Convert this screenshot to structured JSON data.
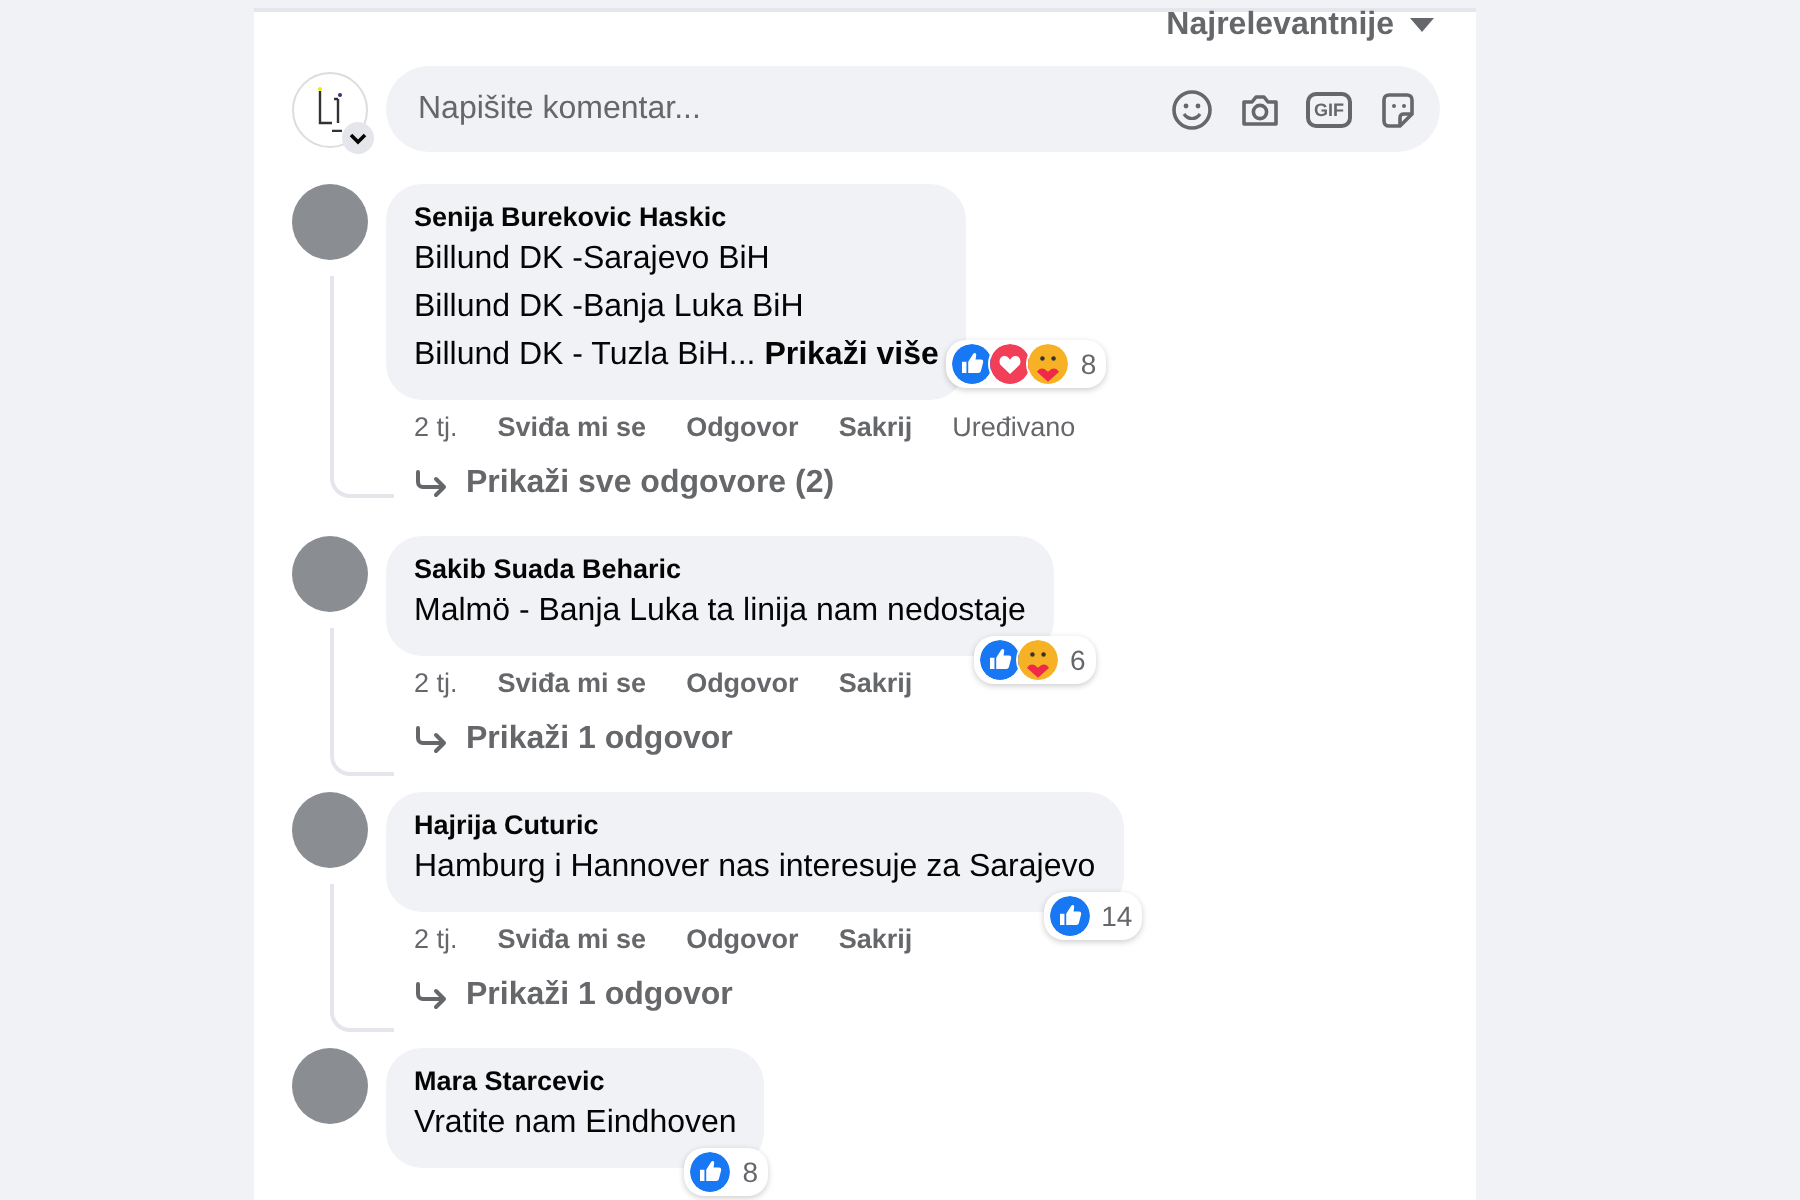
{
  "sort": {
    "label": "Najrelevantnije"
  },
  "composer": {
    "placeholder": "Napišite komentar...",
    "gif_label": "GIF"
  },
  "comments": [
    {
      "author": "Senija Burekovic Haskic",
      "lines": [
        "Billund DK -Sarajevo BiH",
        "Billund DK -Banja Luka BiH",
        "Billund DK - Tuzla BiH..."
      ],
      "more": "Prikaži više",
      "reactions": [
        {
          "kind": "like"
        },
        {
          "kind": "love"
        },
        {
          "kind": "care"
        }
      ],
      "count": "8",
      "time": "2 tj.",
      "actions": [
        "Sviđa mi se",
        "Odgovor",
        "Sakrij"
      ],
      "edited": "Uređivano",
      "replies": "Prikaži sve odgovore (2)"
    },
    {
      "author": "Sakib Suada Beharic",
      "lines": [
        "Malmö - Banja Luka ta linija nam nedostaje"
      ],
      "reactions": [
        {
          "kind": "like"
        },
        {
          "kind": "care"
        }
      ],
      "count": "6",
      "time": "2 tj.",
      "actions": [
        "Sviđa mi se",
        "Odgovor",
        "Sakrij"
      ],
      "replies": "Prikaži 1 odgovor"
    },
    {
      "author": "Hajrija Cuturic",
      "lines": [
        "Hamburg i Hannover nas interesuje za Sarajevo"
      ],
      "reactions": [
        {
          "kind": "like"
        }
      ],
      "count": "14",
      "time": "2 tj.",
      "actions": [
        "Sviđa mi se",
        "Odgovor",
        "Sakrij"
      ],
      "replies": "Prikaži 1 odgovor"
    },
    {
      "author": "Mara Starcevic",
      "lines": [
        "Vratite nam Eindhoven"
      ],
      "reactions": [
        {
          "kind": "like"
        }
      ],
      "count": "8"
    }
  ]
}
